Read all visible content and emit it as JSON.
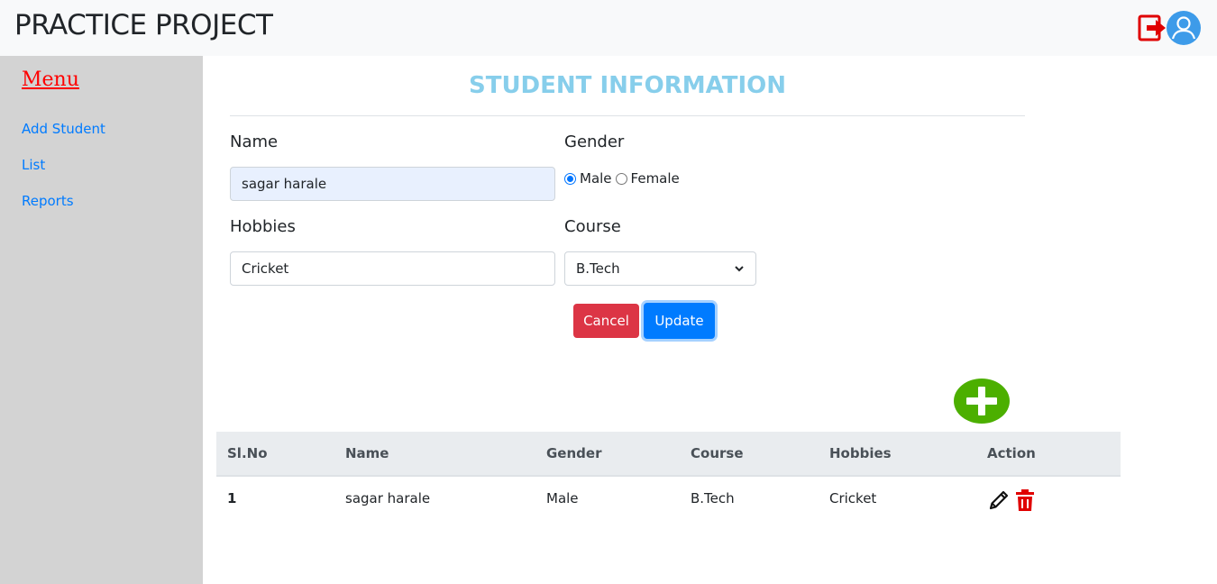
{
  "header": {
    "brand": "PRACTICE PROJECT"
  },
  "sidebar": {
    "title": "Menu",
    "items": [
      {
        "label": "Add Student"
      },
      {
        "label": "List"
      },
      {
        "label": "Reports"
      }
    ]
  },
  "form": {
    "title": "STUDENT INFORMATION",
    "name_label": "Name",
    "name_value": "sagar harale",
    "gender_label": "Gender",
    "gender_options": [
      {
        "label": "Male",
        "checked": true
      },
      {
        "label": "Female",
        "checked": false
      }
    ],
    "hobbies_label": "Hobbies",
    "hobbies_value": "Cricket",
    "course_label": "Course",
    "course_selected": "B.Tech",
    "cancel_label": "Cancel",
    "update_label": "Update"
  },
  "table": {
    "columns": [
      "Sl.No",
      "Name",
      "Gender",
      "Course",
      "Hobbies",
      "Action"
    ],
    "rows": [
      {
        "slno": "1",
        "name": "sagar harale",
        "gender": "Male",
        "course": "B.Tech",
        "hobbies": "Cricket"
      }
    ]
  },
  "colors": {
    "title": "#87ceeb",
    "menu_title": "#ff0000",
    "link": "#007bff",
    "cancel": "#dc3545",
    "update": "#007bff",
    "add": "#4caf00",
    "delete": "#e00000"
  },
  "icons": [
    "logout-icon",
    "user-avatar-icon",
    "chevron-down-icon",
    "plus-circle-icon",
    "pencil-icon",
    "trash-icon"
  ]
}
